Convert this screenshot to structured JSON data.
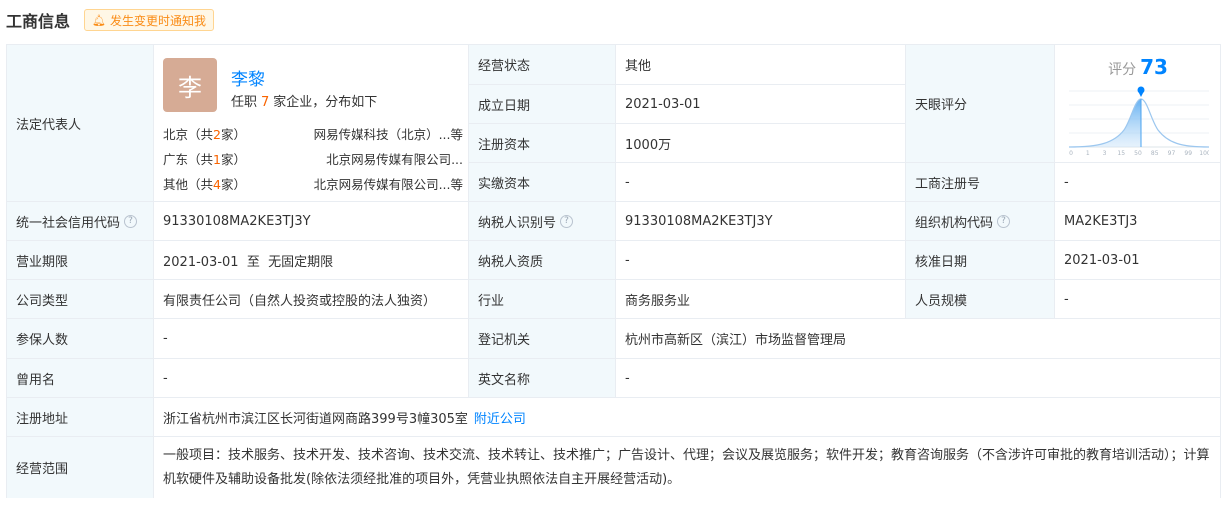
{
  "header": {
    "title": "工商信息",
    "notify_label": "发生变更时通知我"
  },
  "legal_rep": {
    "label": "法定代表人",
    "avatar_char": "李",
    "name": "李黎",
    "positions_prefix": "任职",
    "positions_count": "7",
    "positions_suffix": "家企业，分布如下",
    "distribution": [
      {
        "region": "北京",
        "count_prefix": "（共",
        "count": "2",
        "count_suffix": "家）",
        "company": "网易传媒科技（北京）...等"
      },
      {
        "region": "广东",
        "count_prefix": "（共",
        "count": "1",
        "count_suffix": "家）",
        "company": "北京网易传媒有限公司..."
      },
      {
        "region": "其他",
        "count_prefix": "（共",
        "count": "4",
        "count_suffix": "家）",
        "company": "北京网易传媒有限公司...等"
      }
    ]
  },
  "fields": {
    "status": {
      "label": "经营状态",
      "value": "其他"
    },
    "found_date": {
      "label": "成立日期",
      "value": "2021-03-01"
    },
    "reg_capital": {
      "label": "注册资本",
      "value": "1000万"
    },
    "paid_capital": {
      "label": "实缴资本",
      "value": "-"
    },
    "tianyan_score": {
      "label": "天眼评分"
    },
    "reg_no": {
      "label": "工商注册号",
      "value": "-"
    },
    "credit_code": {
      "label": "统一社会信用代码",
      "value": "91330108MA2KE3TJ3Y"
    },
    "taxpayer_id": {
      "label": "纳税人识别号",
      "value": "91330108MA2KE3TJ3Y"
    },
    "org_code": {
      "label": "组织机构代码",
      "value": "MA2KE3TJ3"
    },
    "business_term": {
      "label": "营业期限",
      "value": "2021-03-01  至  无固定期限"
    },
    "taxpayer_qual": {
      "label": "纳税人资质",
      "value": "-"
    },
    "approval_date": {
      "label": "核准日期",
      "value": "2021-03-01"
    },
    "company_type": {
      "label": "公司类型",
      "value": "有限责任公司（自然人投资或控股的法人独资）"
    },
    "industry": {
      "label": "行业",
      "value": "商务服务业"
    },
    "staff_size": {
      "label": "人员规模",
      "value": "-"
    },
    "insured": {
      "label": "参保人数",
      "value": "-"
    },
    "reg_authority": {
      "label": "登记机关",
      "value": "杭州市高新区（滨江）市场监督管理局"
    },
    "former_name": {
      "label": "曾用名",
      "value": "-"
    },
    "english_name": {
      "label": "英文名称",
      "value": "-"
    },
    "address": {
      "label": "注册地址",
      "value": "浙江省杭州市滨江区长河街道网商路399号3幢305室",
      "link": "附近公司"
    },
    "scope": {
      "label": "经营范围",
      "value": "一般项目：技术服务、技术开发、技术咨询、技术交流、技术转让、技术推广；广告设计、代理；会议及展览服务；软件开发；教育咨询服务（不含涉许可审批的教育培训活动）；计算机软硬件及辅助设备批发(除依法须经批准的项目外，凭营业执照依法自主开展经营活动)。"
    }
  },
  "score": {
    "label": "评分",
    "value": 73,
    "ticks": [
      "0",
      "1",
      "3",
      "15",
      "50",
      "85",
      "97",
      "99",
      "100"
    ]
  },
  "colors": {
    "accent": "#0084ff",
    "label_bg": "#f2f9fc",
    "orange": "#fa6400",
    "border": "#e9edf2"
  }
}
